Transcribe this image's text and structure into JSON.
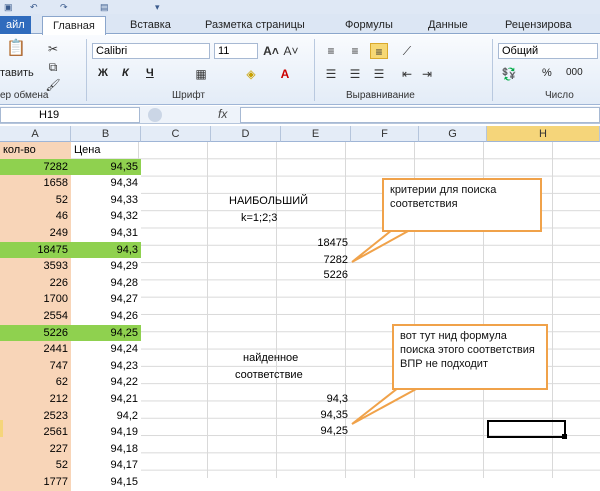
{
  "tabs": [
    {
      "label": "айл"
    },
    {
      "label": "Главная"
    },
    {
      "label": "Вставка"
    },
    {
      "label": "Разметка страницы"
    },
    {
      "label": "Формулы"
    },
    {
      "label": "Данные"
    },
    {
      "label": "Рецензирова"
    }
  ],
  "ribbon": {
    "clipboard": {
      "paste_label": "тавить",
      "group_label": "ер обмена"
    },
    "font": {
      "name": "Calibri",
      "size": "11",
      "bold": "Ж",
      "italic": "К",
      "underline": "Ч",
      "group_label": "Шрифт"
    },
    "alignment": {
      "group_label": "Выравнивание"
    },
    "number": {
      "format": "Общий",
      "percent": "%",
      "thousands": "000",
      "group_label": "Число"
    }
  },
  "formula_bar": {
    "name_box": "H19",
    "fx": "fx"
  },
  "columns": [
    "A",
    "B",
    "C",
    "D",
    "E",
    "F",
    "G",
    "H"
  ],
  "sheet": {
    "header": {
      "a": "кол-во",
      "b": "Цена"
    },
    "rows": [
      {
        "a": "7282",
        "b": "94,35"
      },
      {
        "a": "1658",
        "b": "94,34"
      },
      {
        "a": "52",
        "b": "94,33"
      },
      {
        "a": "46",
        "b": "94,32"
      },
      {
        "a": "249",
        "b": "94,31"
      },
      {
        "a": "18475",
        "b": "94,3"
      },
      {
        "a": "3593",
        "b": "94,29"
      },
      {
        "a": "226",
        "b": "94,28"
      },
      {
        "a": "1700",
        "b": "94,27"
      },
      {
        "a": "2554",
        "b": "94,26"
      },
      {
        "a": "5226",
        "b": "94,25"
      },
      {
        "a": "2441",
        "b": "94,24"
      },
      {
        "a": "747",
        "b": "94,23"
      },
      {
        "a": "62",
        "b": "94,22"
      },
      {
        "a": "212",
        "b": "94,21"
      },
      {
        "a": "2523",
        "b": "94,2"
      },
      {
        "a": "2561",
        "b": "94,19"
      },
      {
        "a": "227",
        "b": "94,18"
      },
      {
        "a": "52",
        "b": "94,17"
      },
      {
        "a": "1777",
        "b": "94,15"
      }
    ],
    "largest_label_1": "НАИБОЛЬШИЙ",
    "largest_label_2": "k=1;2;3",
    "largest_values": [
      "18475",
      "7282",
      "5226"
    ],
    "found_label_1": "найденное",
    "found_label_2": "соответствие",
    "found_values": [
      "94,3",
      "94,35",
      "94,25"
    ]
  },
  "callouts": {
    "criteria": "критерии для поиска соответствия",
    "formula_needed": "вот тут нид формула поиска этого соответствия ВПР не подходит"
  },
  "colors": {
    "green": "#8fd14f",
    "peach": "#f8d5b8",
    "callout_border": "#f0a24a",
    "selected_header": "#f5d57a"
  }
}
